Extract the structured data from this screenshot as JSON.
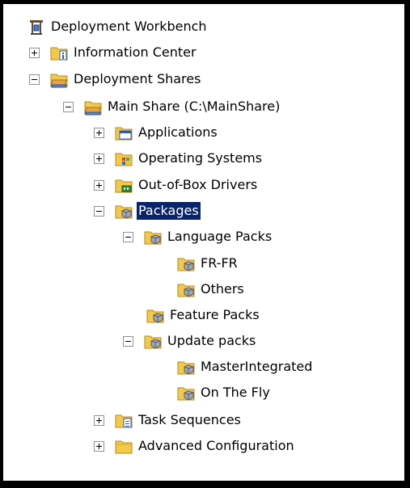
{
  "tree": {
    "root": {
      "label": "Deployment Workbench",
      "icon": "workbench-icon"
    },
    "information_center": {
      "label": "Information Center",
      "icon": "folder-info-icon",
      "expander": "+"
    },
    "deployment_shares": {
      "label": "Deployment Shares",
      "icon": "folder-share-icon",
      "expander": "-"
    },
    "main_share": {
      "label": "Main Share (C:\\MainShare)",
      "icon": "folder-share-icon",
      "expander": "-"
    },
    "applications": {
      "label": "Applications",
      "icon": "folder-apps-icon",
      "expander": "+"
    },
    "operating_systems": {
      "label": "Operating Systems",
      "icon": "folder-os-icon",
      "expander": "+"
    },
    "drivers": {
      "label": "Out-of-Box Drivers",
      "icon": "folder-drivers-icon",
      "expander": "+"
    },
    "packages": {
      "label": "Packages",
      "icon": "folder-package-icon",
      "expander": "-",
      "selected": true
    },
    "language_packs": {
      "label": "Language Packs",
      "icon": "folder-package-icon",
      "expander": "-"
    },
    "fr_fr": {
      "label": "FR-FR",
      "icon": "folder-package-icon"
    },
    "others": {
      "label": "Others",
      "icon": "folder-package-icon"
    },
    "feature_packs": {
      "label": "Feature Packs",
      "icon": "folder-package-icon"
    },
    "update_packs": {
      "label": "Update packs",
      "icon": "folder-package-icon",
      "expander": "-"
    },
    "master_integrated": {
      "label": "MasterIntegrated",
      "icon": "folder-package-icon"
    },
    "on_the_fly": {
      "label": "On The Fly",
      "icon": "folder-package-icon"
    },
    "task_sequences": {
      "label": "Task Sequences",
      "icon": "folder-tasks-icon",
      "expander": "+"
    },
    "advanced_configuration": {
      "label": "Advanced Configuration",
      "icon": "folder-icon",
      "expander": "+"
    }
  },
  "colors": {
    "selection_bg": "#0a246a",
    "selection_text": "#ffffff",
    "folder_yellow": "#f3c94a",
    "border": "#000000"
  }
}
